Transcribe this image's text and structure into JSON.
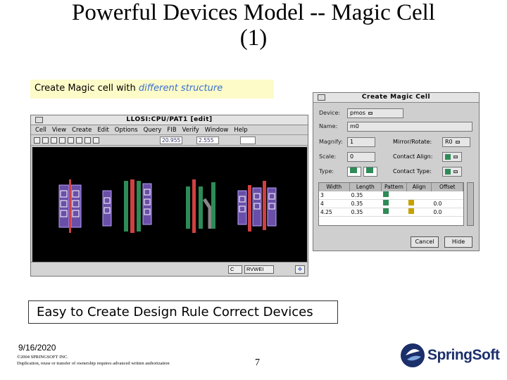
{
  "title": {
    "line1": "Powerful Devices Model -- Magic Cell",
    "line2": "(1)"
  },
  "caption": {
    "prefix": "Create Magic cell with ",
    "accent": "different structure"
  },
  "editor": {
    "title": "LLOSI:CPU/PAT1 [edit]",
    "menus": [
      "Cell",
      "View",
      "Create",
      "Edit",
      "Options",
      "Query",
      "FIB",
      "Verify",
      "Window",
      "Help"
    ],
    "toolbar": {
      "field1": "20.955",
      "field2": "2.555"
    },
    "status": {
      "field": "RVWEI"
    }
  },
  "dialog": {
    "title": "Create Magic Cell",
    "device_label": "Device:",
    "device_value": "pmos",
    "name_label": "Name:",
    "name_value": "m0",
    "magnify_label": "Magnify:",
    "magnify_value": "1",
    "scale_label": "Scale:",
    "scale_value": "0",
    "type_label": "Type:",
    "mirror_label": "Mirror/Rotate:",
    "mirror_value": "R0",
    "contact_align_label": "Contact Align:",
    "contact_type_label": "Contact Type:",
    "columns": [
      "Width",
      "Length",
      "Pattern",
      "Align",
      "Offset"
    ],
    "rows": [
      {
        "width": "3",
        "length": "0.35",
        "offset": ""
      },
      {
        "width": "4",
        "length": "0.35",
        "offset": "0.0"
      },
      {
        "width": "4.25",
        "length": "0.35",
        "offset": "0.0"
      }
    ],
    "cancel_label": "Cancel",
    "hide_label": "Hide"
  },
  "footer_caption": "Easy to Create Design Rule Correct Devices",
  "date": "9/16/2020",
  "copyright_line1": "©2004 SPRINGSOFT INC.",
  "copyright_line2": "Duplication, reuse or transfer of ownership requires advanced written authorization",
  "page_number": "7",
  "logo_text": "SpringSoft",
  "colors": {
    "caption_bg": "#fdfbc8",
    "accent": "#3a6fd0",
    "canvas": "#000000",
    "logo": "#1b2f6b"
  }
}
